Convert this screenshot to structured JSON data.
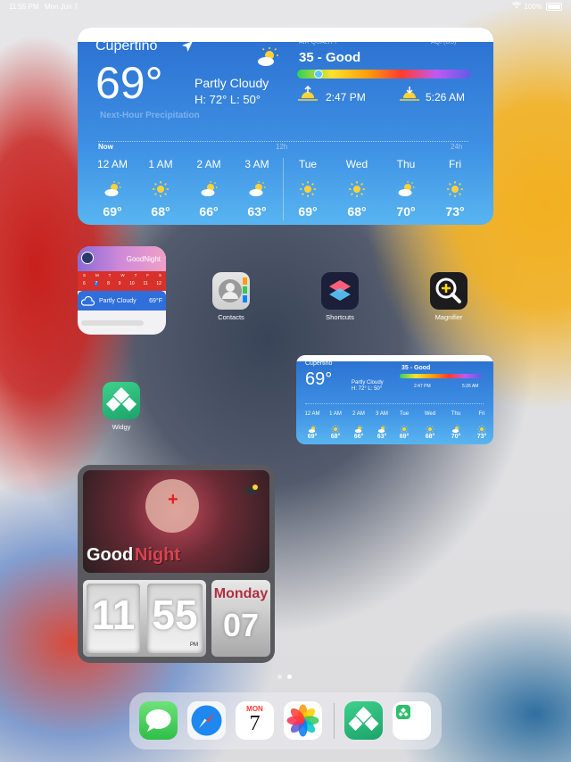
{
  "status_bar": {
    "time": "11:55 PM",
    "date": "Mon Jun 7",
    "battery": "100%"
  },
  "weather_large": {
    "location": "Cupertino",
    "temp": "69°",
    "condition": "Partly Cloudy",
    "hilo": "H: 72°  L: 50°",
    "aqi_label": "AIR QUALITY",
    "aqi_scale": "AQI (US)",
    "aqi_value": "35 - Good",
    "aqi_level": 0.12,
    "sunset": "2:47 PM",
    "sunrise": "5:26 AM",
    "precip_label": "Next-Hour Precipitation",
    "precip_now": "Now",
    "precip_mid": "12h",
    "precip_end": "24h",
    "hourly": [
      {
        "t": "12 AM",
        "temp": "69°"
      },
      {
        "t": "1 AM",
        "temp": "68°"
      },
      {
        "t": "2 AM",
        "temp": "66°"
      },
      {
        "t": "3 AM",
        "temp": "63°"
      }
    ],
    "daily": [
      {
        "t": "Tue",
        "temp": "69°"
      },
      {
        "t": "Wed",
        "temp": "68°"
      },
      {
        "t": "Thu",
        "temp": "70°"
      },
      {
        "t": "Fri",
        "temp": "73°"
      }
    ]
  },
  "stack_widget": {
    "title": "GoodNight",
    "cal_days": [
      "S",
      "M",
      "T",
      "W",
      "T",
      "F",
      "S"
    ],
    "cal_dates": [
      "6",
      "7",
      "8",
      "9",
      "10",
      "11",
      "12"
    ],
    "weather_text": "Partly Cloudy",
    "weather_temp": "69°F"
  },
  "apps": [
    {
      "name": "Contacts"
    },
    {
      "name": "Shortcuts"
    },
    {
      "name": "Magnifier"
    },
    {
      "name": "Widgy"
    }
  ],
  "photo_widget": {
    "greeting_1": "Good",
    "greeting_2": "Night",
    "hour": "11",
    "minute": "55",
    "ampm": "PM",
    "weekday": "Monday",
    "day": "07"
  },
  "dock": {
    "calendar_month": "MON",
    "calendar_day": "7"
  }
}
